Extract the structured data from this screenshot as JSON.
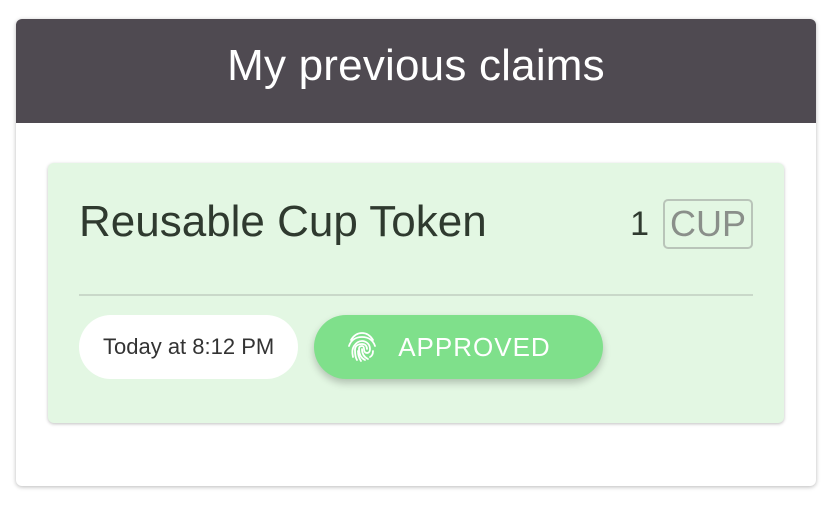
{
  "panel": {
    "title": "My previous claims"
  },
  "claims": [
    {
      "name": "Reusable Cup Token",
      "quantity": "1",
      "unit": "CUP",
      "date": "Today at 8:12 PM",
      "status": "APPROVED",
      "status_icon": "fingerprint-icon"
    }
  ],
  "colors": {
    "header_bg": "#4f4a51",
    "card_bg": "#e3f7e3",
    "status_bg": "#7fe08b"
  }
}
